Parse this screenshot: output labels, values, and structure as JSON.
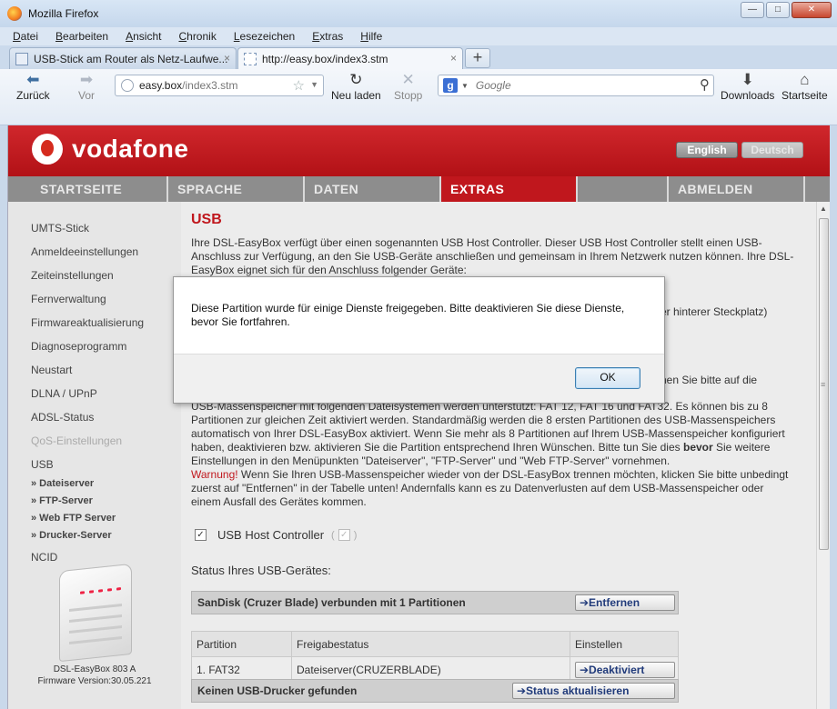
{
  "window": {
    "title": "Mozilla Firefox",
    "buttons": {
      "minimize": "—",
      "maximize": "□",
      "close": "✕"
    }
  },
  "menubar": [
    "Datei",
    "Bearbeiten",
    "Ansicht",
    "Chronik",
    "Lesezeichen",
    "Extras",
    "Hilfe"
  ],
  "tabs": [
    {
      "label": "USB-Stick am Router als Netz-Laufwe...",
      "close": "×"
    },
    {
      "label": "http://easy.box/index3.stm",
      "close": "×"
    }
  ],
  "new_tab": "+",
  "toolbar": {
    "back": "Zurück",
    "back_icon": "arrow-left-icon",
    "forward": "Vor",
    "forward_icon": "arrow-right-icon",
    "reload": "Neu laden",
    "reload_icon": "reload-icon",
    "stop": "Stopp",
    "stop_icon": "close-icon",
    "downloads": "Downloads",
    "downloads_icon": "download-arrow-icon",
    "home": "Startseite",
    "home_icon": "home-icon"
  },
  "urlbar": {
    "host": "easy.box",
    "path": "/index3.stm"
  },
  "search": {
    "engine_badge": "g",
    "placeholder": "Google"
  },
  "brand": {
    "name": "vodafone",
    "color": "#c0171d"
  },
  "language": {
    "english": "English",
    "german": "Deutsch"
  },
  "topnav": [
    "STARTSEITE",
    "SPRACHE",
    "DATEN",
    "EXTRAS",
    "",
    "ABMELDEN"
  ],
  "sidebar": {
    "items": [
      "UMTS-Stick",
      "Anmeldeeinstellungen",
      "Zeiteinstellungen",
      "Fernverwaltung",
      "Firmwareaktualisierung",
      "Diagnoseprogramm",
      "Neustart",
      "DLNA / UPnP",
      "ADSL-Status",
      "QoS-Einstellungen",
      "USB"
    ],
    "subitems": [
      "» Dateiserver",
      "» FTP-Server",
      "» Web FTP Server",
      "» Drucker-Server"
    ],
    "last": "NCID",
    "device_name": "DSL-EasyBox 803 A",
    "firmware": "Firmware Version:30.05.221"
  },
  "main": {
    "heading": "USB",
    "intro": "Ihre DSL-EasyBox verfügt über einen sogenannten USB Host Controller. Dieser USB Host Controller stellt einen USB-Anschluss zur Verfügung, an den Sie USB-Geräte anschließen und gemeinsam in Ihrem Netzwerk nutzen können. Ihre DSL-EasyBox eignet sich für den Anschluss folgender Geräte:",
    "partial1": "er hinterer Steckplatz)",
    "partial2": "nen Sie bitte auf die",
    "p2_lines": [
      "USB-Massenspeicher mit folgenden Dateisystemen werden unterstützt: FAT 12, FAT 16 und FAT32. Es können bis zu 8",
      "Partitionen zur gleichen Zeit aktiviert werden. Standardmäßig werden die 8 ersten Partitionen des USB-Massenspeichers",
      "automatisch von Ihrer DSL-EasyBox aktiviert. Wenn Sie mehr als 8 Partitionen auf Ihrem USB-Massenspeicher konfiguriert"
    ],
    "p2_line4_a": "haben, deaktivieren bzw. aktivieren Sie die Partition entsprechend Ihren Wünschen. Bitte tun Sie dies ",
    "p2_line4_bold": "bevor",
    "p2_line4_b": " Sie weitere",
    "p2_line5": "Einstellungen in den Menüpunkten \"Dateiserver\", \"FTP-Server\" und \"Web FTP-Server\" vornehmen.",
    "warning_label": "Warnung!",
    "warning_text": " Wenn Sie Ihren USB-Massenspeicher wieder von der DSL-EasyBox trennen möchten, klicken Sie bitte unbedingt",
    "warning_line2": "zuerst auf \"Entfernen\" in der Tabelle unten! Andernfalls kann es zu Datenverlusten auf dem USB-Massenspeicher oder",
    "warning_line3": "einem Ausfall des Gerätes kommen.",
    "checkbox_label": "USB Host Controller",
    "status_label": "Status Ihres USB-Gerätes:",
    "device_row": "SanDisk (Cruzer Blade) verbunden mit 1 Partitionen",
    "remove_button": "➔Entfernen",
    "table_headers": [
      "Partition",
      "Freigabestatus",
      "Einstellen"
    ],
    "table_rows": [
      [
        "1. FAT32",
        "Dateiserver(CRUZERBLADE)",
        "➔Deaktiviert"
      ]
    ],
    "printer_row": "Keinen USB-Drucker gefunden",
    "refresh_button": "➔Status aktualisieren"
  },
  "dialog": {
    "message_line1": "Diese Partition wurde für einige Dienste freigegeben. Bitte deaktivieren Sie diese Dienste,",
    "message_line2": "bevor Sie fortfahren.",
    "ok": "OK"
  }
}
